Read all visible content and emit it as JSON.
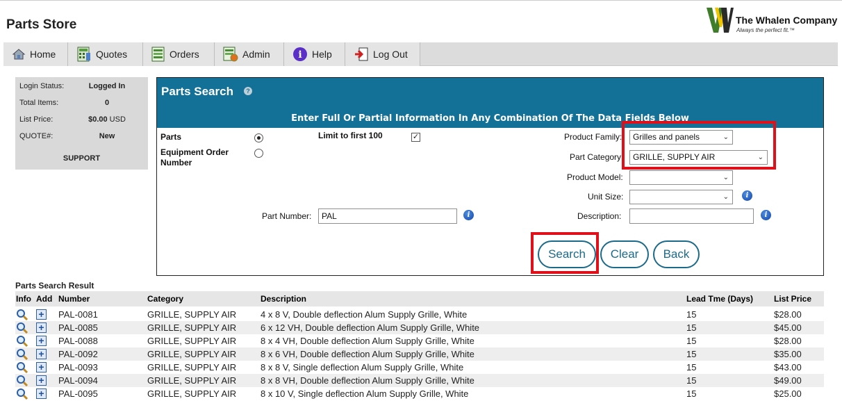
{
  "app": {
    "title": "Parts Store"
  },
  "logo": {
    "name": "The Whalen Company",
    "tagline": "Always the perfect fit.™"
  },
  "nav": [
    {
      "label": "Home",
      "icon": "home-icon"
    },
    {
      "label": "Quotes",
      "icon": "calculator-icon"
    },
    {
      "label": "Orders",
      "icon": "spreadsheet-icon"
    },
    {
      "label": "Admin",
      "icon": "admin-sheet-icon"
    },
    {
      "label": "Help",
      "icon": "help-circle-icon"
    },
    {
      "label": "Log Out",
      "icon": "logout-icon"
    }
  ],
  "sidebar": {
    "rows": [
      {
        "key": "Login Status:",
        "value": "Logged In"
      },
      {
        "key": "Total Items:",
        "value": "0"
      },
      {
        "key": "List Price:",
        "value": "$0.00",
        "unit": "USD"
      },
      {
        "key": "QUOTE#:",
        "value": "New"
      }
    ],
    "support": "SUPPORT"
  },
  "search": {
    "title": "Parts Search",
    "subtitle": "Enter Full Or Partial Information In Any Combination Of The Data Fields Below",
    "mode_parts": "Parts",
    "mode_equipment": "Equipment Order Number",
    "limit_label": "Limit to first 100",
    "limit_checked": true,
    "product_family_label": "Product Family:",
    "product_family_value": "Grilles and panels",
    "part_category_label": "Part Category:",
    "part_category_value": "GRILLE, SUPPLY AIR",
    "product_model_label": "Product Model:",
    "product_model_value": "",
    "unit_size_label": "Unit Size:",
    "unit_size_value": "",
    "part_number_label": "Part Number:",
    "part_number_value": "PAL",
    "description_label": "Description:",
    "description_value": "",
    "buttons": {
      "search": "Search",
      "clear": "Clear",
      "back": "Back"
    },
    "highlight_color": "#e0101a"
  },
  "results": {
    "title": "Parts Search Result",
    "columns": [
      "Info",
      "Add",
      "Number",
      "Category",
      "Description",
      "Lead Tme (Days)",
      "List Price"
    ],
    "rows": [
      {
        "number": "PAL-0081",
        "category": "GRILLE, SUPPLY AIR",
        "description": "4 x 8 V, Double deflection Alum Supply Grille, White",
        "lead": "15",
        "price": "$28.00"
      },
      {
        "number": "PAL-0085",
        "category": "GRILLE, SUPPLY AIR",
        "description": "6 x 12 VH, Double deflection Alum Supply Grille, White",
        "lead": "15",
        "price": "$45.00"
      },
      {
        "number": "PAL-0088",
        "category": "GRILLE, SUPPLY AIR",
        "description": "8 x 4 VH, Double deflection Alum Supply Grille, White",
        "lead": "15",
        "price": "$28.00"
      },
      {
        "number": "PAL-0092",
        "category": "GRILLE, SUPPLY AIR",
        "description": "8 x 6 VH, Double deflection Alum Supply Grille, White",
        "lead": "15",
        "price": "$35.00"
      },
      {
        "number": "PAL-0093",
        "category": "GRILLE, SUPPLY AIR",
        "description": "8 x 8 V, Single deflection Alum Supply Grille, White",
        "lead": "15",
        "price": "$43.00"
      },
      {
        "number": "PAL-0094",
        "category": "GRILLE, SUPPLY AIR",
        "description": "8 x 8 VH, Double deflection Alum Supply Grille, White",
        "lead": "15",
        "price": "$49.00"
      },
      {
        "number": "PAL-0095",
        "category": "GRILLE, SUPPLY AIR",
        "description": "8 x 10 V, Single deflection Alum Supply Grille, White",
        "lead": "15",
        "price": "$25.00"
      }
    ]
  },
  "colors": {
    "header_blue": "#137096",
    "button_teal": "#1c6a8a",
    "highlight_red": "#e0101a"
  }
}
